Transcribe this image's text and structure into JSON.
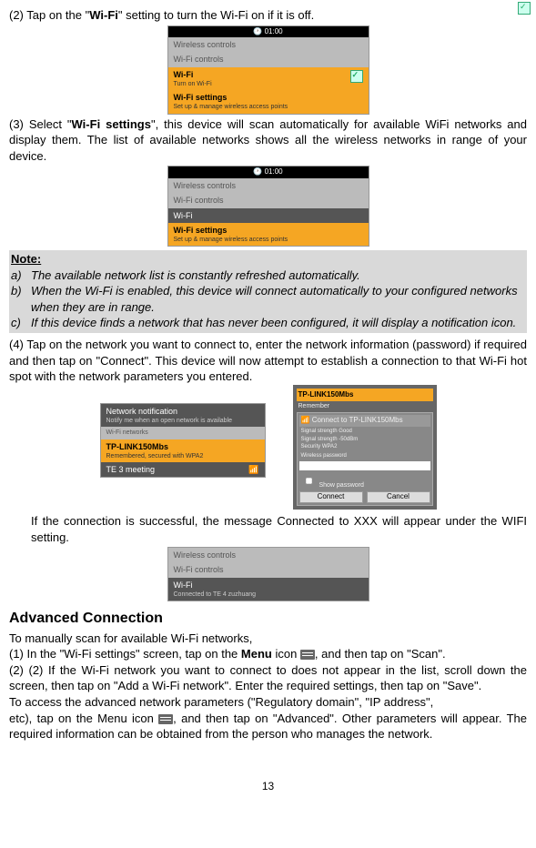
{
  "step2": {
    "prefix": "(2) Tap on the \"",
    "bold": "Wi-Fi",
    "suffix": "\" setting to turn the Wi-Fi on if it is off."
  },
  "ui1": {
    "time": "01:00",
    "row1": "Wireless controls",
    "row2": "Wi-Fi controls",
    "wifi": "Wi-Fi",
    "wifi_sub": "Turn on Wi-Fi",
    "settings": "Wi-Fi settings",
    "settings_sub": "Set up & manage wireless access points"
  },
  "step3": {
    "prefix": "(3) Select \"",
    "bold": "Wi-Fi settings",
    "suffix": "\", this device will scan automatically for available WiFi networks and display them. The list of available networks shows all the wireless networks in range of your device."
  },
  "ui2": {
    "time": "01:00",
    "row1": "Wireless controls",
    "row2": "Wi-Fi controls",
    "wifi": "Wi-Fi",
    "settings": "Wi-Fi settings",
    "settings_sub": "Set up & manage wireless access points"
  },
  "note": {
    "title": "Note:",
    "a": "The available network list is constantly refreshed automatically.",
    "b": "When the Wi-Fi is enabled, this device will connect automatically to your configured networks when they are in range.",
    "c": "If this device finds a network that has never been configured, it will display a notification icon."
  },
  "step4": {
    "text": "(4) Tap on the network you want to connect to, enter the network information (password) if required and then tap on \"Connect\". This device will now attempt to establish a connection to that Wi-Fi hot spot with the network parameters you entered."
  },
  "uiList": {
    "header": "Network notification",
    "header_sub": "Notify me when an open network is available",
    "section": "Wi-Fi networks",
    "net1": "TP-LINK150Mbs",
    "net1_sub": "Remembered, secured with WPA2",
    "net2": "TE 3 meeting"
  },
  "uiDialog": {
    "title": "TP-LINK150Mbs",
    "sub": "Remember",
    "connect_to": "Connect to TP-LINK150Mbs",
    "strength": "Signal strength  Good",
    "signal": "Signal strength  -50dBm",
    "security": "Security  WPA2",
    "show": "Show password",
    "pwd_label": "Wireless password",
    "btn_connect": "Connect",
    "btn_cancel": "Cancel"
  },
  "step4b": {
    "text": "If the connection is successful, the message Connected to XXX will appear under the WIFI setting."
  },
  "uiConnected": {
    "row1": "Wireless controls",
    "row2": "Wi-Fi controls",
    "wifi": "Wi-Fi",
    "wifi_sub": "Connected to TE 4 zuzhuang"
  },
  "advanced": {
    "heading": "Advanced Connection",
    "intro": "To manually scan for available Wi-Fi networks,",
    "s1a": "(1) In the \"Wi-Fi settings\" screen, tap on the ",
    "s1b_bold": "Menu",
    "s1c": " icon ",
    "s1d": ", and then tap on \"Scan\".",
    "s2": "(2) If the Wi-Fi network you want to connect to does not appear in the list, scroll down the screen, then tap on \"Add a Wi-Fi network\". Enter the required settings, then tap on \"Save\".",
    "p1": "To access the advanced network parameters (\"Regulatory domain\", \"IP address\",",
    "p2a": "etc), tap on the Menu icon ",
    "p2b": ", and then tap on \"Advanced\". Other parameters will appear. The required information can be obtained from the person who manages the network."
  },
  "pageNum": "13"
}
